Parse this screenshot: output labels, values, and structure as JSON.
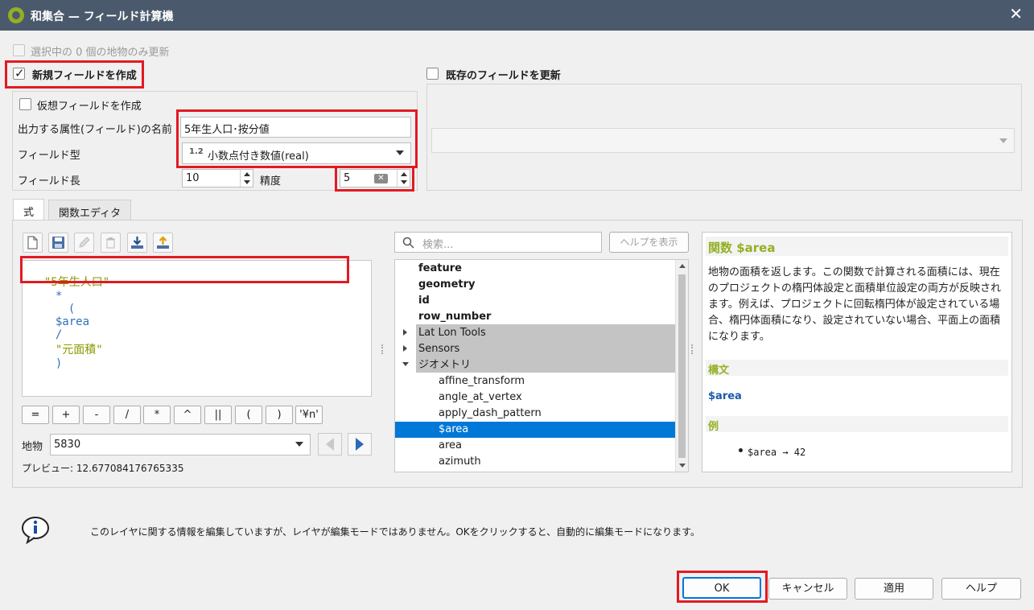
{
  "window": {
    "title": "和集合 — フィールド計算機",
    "close_glyph": "✕"
  },
  "top": {
    "selected_only_label": "選択中の 0 個の地物のみ更新",
    "new_field_label": "新規フィールドを作成",
    "update_existing_label": "既存のフィールドを更新"
  },
  "new_field": {
    "virtual_label": "仮想フィールドを作成",
    "name_label": "出力する属性(フィールド)の名前",
    "name_value": "5年生人口･按分値",
    "type_label": "フィールド型",
    "type_prefix": "1.2",
    "type_value": "小数点付き数値(real)",
    "length_label": "フィールド長",
    "length_value": "10",
    "precision_label": "精度",
    "precision_value": "5"
  },
  "tabs": {
    "expression": "式",
    "function_editor": "関数エディタ"
  },
  "expression": {
    "tokens": [
      "\"5年生人口\"",
      "*",
      "(",
      "$area",
      "/",
      "\"元面積\"",
      ")"
    ]
  },
  "operators": [
    "=",
    "+",
    "-",
    "/",
    "*",
    "^",
    "||",
    "(",
    ")",
    "'¥n'"
  ],
  "feature": {
    "label": "地物",
    "value": "5830"
  },
  "preview": {
    "text": "プレビュー: 12.677084176765335"
  },
  "search": {
    "placeholder": "検索...",
    "help_button": "ヘルプを表示"
  },
  "tree": {
    "items": [
      {
        "label": "feature",
        "bold": true
      },
      {
        "label": "geometry",
        "bold": true
      },
      {
        "label": "id",
        "bold": true
      },
      {
        "label": "row_number",
        "bold": true
      },
      {
        "label": "Lat Lon Tools",
        "group": true,
        "expanded": false
      },
      {
        "label": "Sensors",
        "group": true,
        "expanded": false
      },
      {
        "label": "ジオメトリ",
        "group": true,
        "expanded": true
      },
      {
        "label": "affine_transform",
        "child": true
      },
      {
        "label": "angle_at_vertex",
        "child": true
      },
      {
        "label": "apply_dash_pattern",
        "child": true
      },
      {
        "label": "$area",
        "child": true,
        "selected": true
      },
      {
        "label": "area",
        "child": true
      },
      {
        "label": "azimuth",
        "child": true
      }
    ]
  },
  "help": {
    "title": "関数 $area",
    "description": "地物の面積を返します。この関数で計算される面積には、現在のプロジェクトの楕円体設定と面積単位設定の両方が反映されます。例えば、プロジェクトに回転楕円体が設定されている場合、楕円体面積になり、設定されていない場合、平面上の面積になります。",
    "syntax_header": "構文",
    "syntax": "$area",
    "example_header": "例",
    "example": "$area → 42"
  },
  "info": {
    "message": "このレイヤに関する情報を編集していますが、レイヤが編集モードではありません。OKをクリックすると、自動的に編集モードになります。"
  },
  "buttons": {
    "ok": "OK",
    "cancel": "キャンセル",
    "apply": "適用",
    "help": "ヘルプ"
  },
  "colors": {
    "titlebar": "#4a5a6c",
    "highlight_red": "#e21a22",
    "help_title_green": "#93b023",
    "syntax_blue": "#1a5aa8",
    "selection_blue": "#0078d7",
    "string_green": "#8a9a00",
    "field_blue": "#3070b8"
  }
}
